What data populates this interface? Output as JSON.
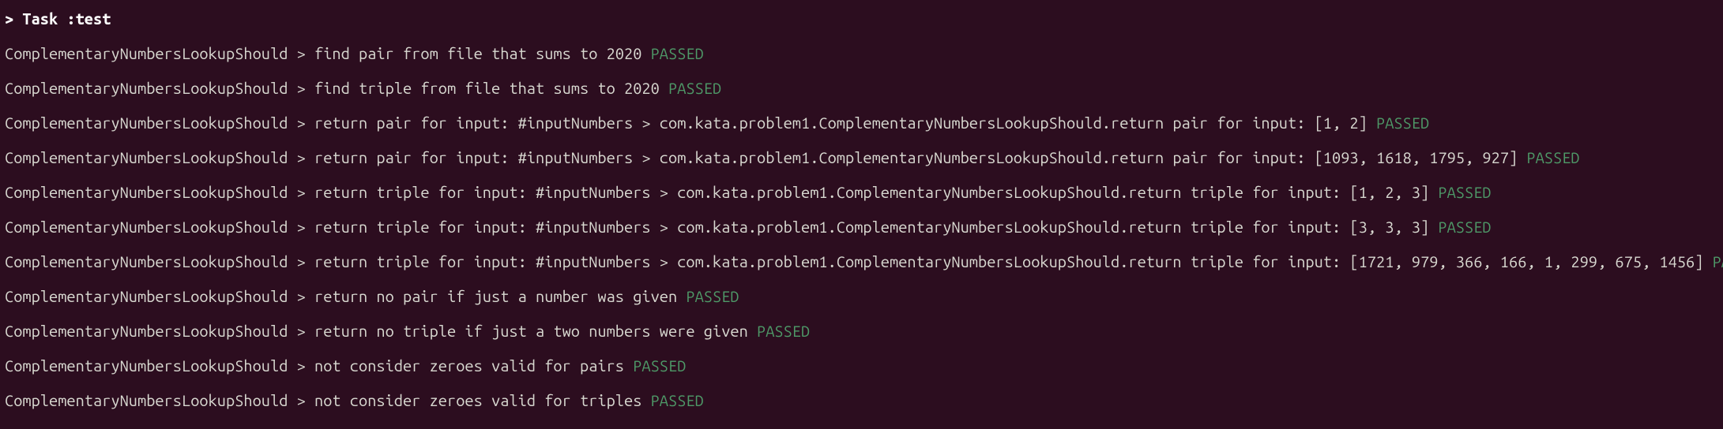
{
  "header": {
    "prompt": ">",
    "task": "Task :test"
  },
  "tests": [
    {
      "desc": "ComplementaryNumbersLookupShould > find pair from file that sums to 2020",
      "status": "PASSED"
    },
    {
      "desc": "ComplementaryNumbersLookupShould > find triple from file that sums to 2020",
      "status": "PASSED"
    },
    {
      "desc": "ComplementaryNumbersLookupShould > return pair for input: #inputNumbers > com.kata.problem1.ComplementaryNumbersLookupShould.return pair for input: [1, 2]",
      "status": "PASSED"
    },
    {
      "desc": "ComplementaryNumbersLookupShould > return pair for input: #inputNumbers > com.kata.problem1.ComplementaryNumbersLookupShould.return pair for input: [1093, 1618, 1795, 927]",
      "status": "PASSED"
    },
    {
      "desc": "ComplementaryNumbersLookupShould > return triple for input: #inputNumbers > com.kata.problem1.ComplementaryNumbersLookupShould.return triple for input: [1, 2, 3]",
      "status": "PASSED"
    },
    {
      "desc": "ComplementaryNumbersLookupShould > return triple for input: #inputNumbers > com.kata.problem1.ComplementaryNumbersLookupShould.return triple for input: [3, 3, 3]",
      "status": "PASSED"
    },
    {
      "desc": "ComplementaryNumbersLookupShould > return triple for input: #inputNumbers > com.kata.problem1.ComplementaryNumbersLookupShould.return triple for input: [1721, 979, 366, 166, 1, 299, 675, 1456]",
      "status": "PASSED"
    },
    {
      "desc": "ComplementaryNumbersLookupShould > return no pair if just a number was given",
      "status": "PASSED"
    },
    {
      "desc": "ComplementaryNumbersLookupShould > return no triple if just a two numbers were given",
      "status": "PASSED"
    },
    {
      "desc": "ComplementaryNumbersLookupShould > not consider zeroes valid for pairs",
      "status": "PASSED"
    },
    {
      "desc": "ComplementaryNumbersLookupShould > not consider zeroes valid for triples",
      "status": "PASSED"
    }
  ]
}
